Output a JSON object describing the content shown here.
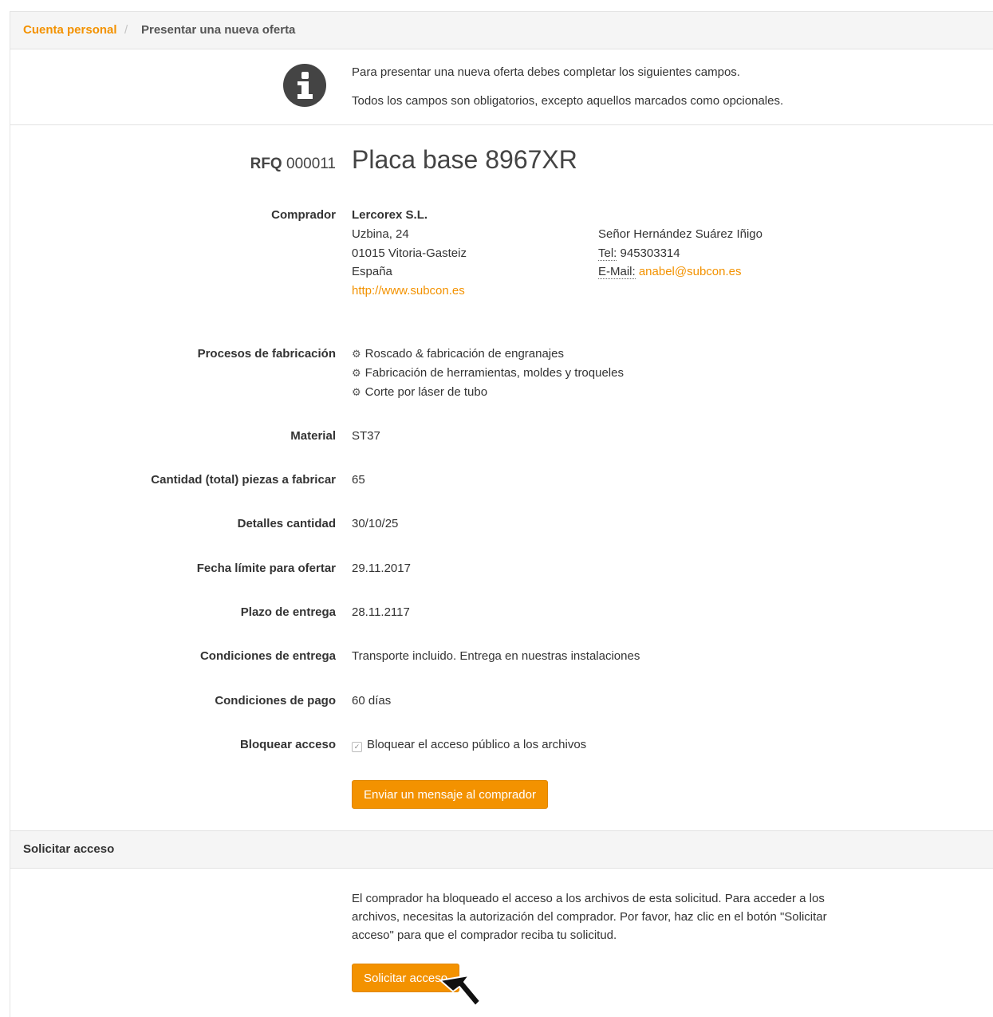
{
  "breadcrumb": {
    "parent": "Cuenta personal",
    "separator": "/",
    "current": "Presentar una nueva oferta"
  },
  "info": {
    "icon": "info-circle-icon",
    "line1": "Para presentar una nueva oferta debes completar los siguientes campos.",
    "line2": "Todos los campos son obligatorios, excepto aquellos marcados como opcionales."
  },
  "rfq": {
    "prefix": "RFQ",
    "number": "000011",
    "title": "Placa base 8967XR"
  },
  "buyer": {
    "label": "Comprador",
    "company": "Lercorex S.L.",
    "street": "Uzbina, 24",
    "city": "01015 Vitoria-Gasteiz",
    "country": "España",
    "website": "http://www.subcon.es",
    "contact_name": "Señor Hernández Suárez Iñigo",
    "tel_label": "Tel:",
    "tel": "945303314",
    "email_label": "E-Mail:",
    "email": "anabel@subcon.es"
  },
  "processes": {
    "label": "Procesos de fabricación",
    "icon": "gears-icon",
    "items": [
      "Roscado & fabricación de engranajes",
      "Fabricación de herramientas, moldes y troqueles",
      "Corte por láser de tubo"
    ]
  },
  "fields": {
    "material_label": "Material",
    "material": "ST37",
    "quantity_label": "Cantidad (total) piezas a fabricar",
    "quantity": "65",
    "quantity_details_label": "Detalles cantidad",
    "quantity_details": "30/10/25",
    "deadline_label": "Fecha límite para ofertar",
    "deadline": "29.11.2017",
    "delivery_time_label": "Plazo de entrega",
    "delivery_time": "28.11.2117",
    "delivery_conditions_label": "Condiciones de entrega",
    "delivery_conditions": "Transporte incluido. Entrega en nuestras instalaciones",
    "payment_conditions_label": "Condiciones de pago",
    "payment_conditions": "60 días",
    "block_access_label": "Bloquear acceso",
    "block_access_text": "Bloquear el acceso público a los archivos",
    "block_access_checked": true
  },
  "message_button": "Enviar un mensaje al comprador",
  "access_section": {
    "heading": "Solicitar acceso",
    "text": "El comprador ha bloqueado el acceso a los archivos de esta solicitud. Para acceder a los archivos, necesitas la autorización del comprador. Por favor, haz clic en el botón \"Solicitar acceso\" para que el comprador reciba tu solicitud.",
    "button": "Solicitar acceso"
  },
  "colors": {
    "accent": "#f39200",
    "header_bg": "#f5f5f5",
    "text": "#333333"
  }
}
